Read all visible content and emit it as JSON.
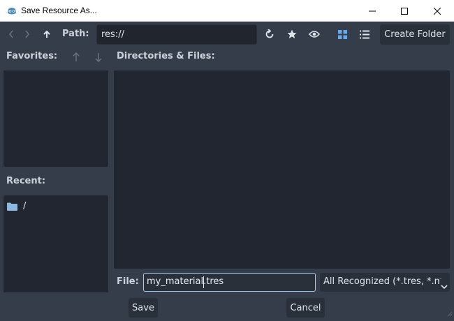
{
  "window": {
    "title": "Save Resource As..."
  },
  "toolbar": {
    "path_label": "Path:",
    "path_value": "res://",
    "create_folder_label": "Create Folder"
  },
  "favorites": {
    "label": "Favorites:"
  },
  "recent": {
    "label": "Recent:",
    "items": [
      {
        "icon": "folder-icon",
        "name": "/"
      }
    ]
  },
  "files": {
    "label": "Directories & Files:"
  },
  "footer": {
    "file_label": "File:",
    "file_value": "my_material.tres",
    "filter_value": "All Recognized (*.tres, *.m",
    "save_label": "Save",
    "cancel_label": "Cancel"
  },
  "colors": {
    "accent": "#a8cdf0",
    "background": "#363d4a",
    "panel": "#212630",
    "active_view_icon": "#6aa8e8",
    "folder": "#8fb8e0"
  }
}
